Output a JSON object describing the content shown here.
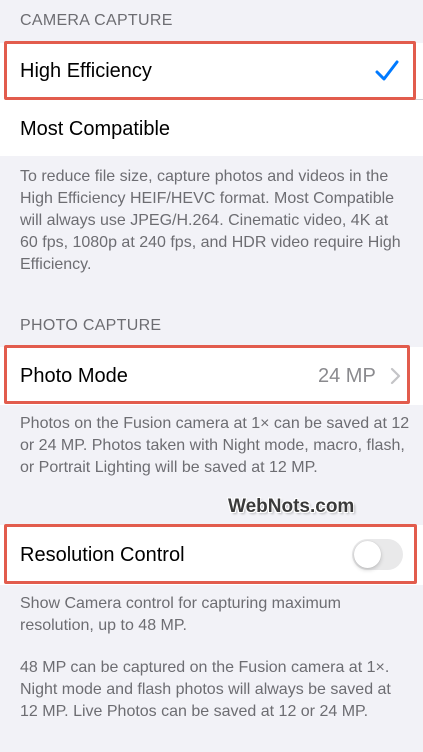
{
  "camera_capture": {
    "header": "CAMERA CAPTURE",
    "options": [
      {
        "label": "High Efficiency",
        "selected": true
      },
      {
        "label": "Most Compatible",
        "selected": false
      }
    ],
    "footer": "To reduce file size, capture photos and videos in the High Efficiency HEIF/HEVC format. Most Compatible will always use JPEG/H.264. Cinematic video, 4K at 60 fps, 1080p at 240 fps, and HDR video require High Efficiency."
  },
  "photo_capture": {
    "header": "PHOTO CAPTURE",
    "photo_mode": {
      "label": "Photo Mode",
      "value": "24 MP"
    },
    "footer": "Photos on the Fusion camera at 1× can be saved at 12 or 24 MP. Photos taken with Night mode, macro, flash, or Portrait Lighting will be saved at 12 MP."
  },
  "resolution_control": {
    "label": "Resolution Control",
    "enabled": false,
    "footer_1": "Show Camera control for capturing maximum resolution, up to 48 MP.",
    "footer_2": "48 MP can be captured on the Fusion camera at 1×. Night mode and flash photos will always be saved at 12 MP. Live Photos can be saved at 12 or 24 MP."
  },
  "watermark": "WebNots.com",
  "colors": {
    "accent": "#007aff",
    "highlight_border": "#e25c4d",
    "secondary_text": "#6d6d72",
    "toggle_off": "#e9e9ea"
  }
}
